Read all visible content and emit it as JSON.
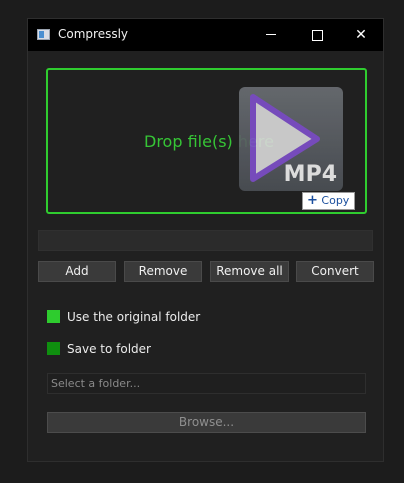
{
  "window": {
    "title": "Compressly",
    "controls": [
      "minimize",
      "maximize",
      "close"
    ]
  },
  "dropzone": {
    "text": "Drop file(s) here",
    "drag_icon": {
      "name": "mp4-file-icon",
      "label": "MP4"
    },
    "drag_badge": {
      "icon": "plus-icon",
      "label": "Copy"
    },
    "border_color": "#2fcc2f",
    "text_color": "#36c536"
  },
  "progress": {
    "value": 0
  },
  "buttons": {
    "add": "Add",
    "remove": "Remove",
    "remove_all": "Remove all",
    "convert": "Convert"
  },
  "options": {
    "use_original_folder": {
      "label": "Use the original folder",
      "color": "#2ecc2e"
    },
    "save_to_folder": {
      "label": "Save to folder",
      "color": "#0f8f0f"
    }
  },
  "folder": {
    "placeholder": "Select a folder...",
    "value": ""
  },
  "browse": {
    "label": "Browse..."
  }
}
